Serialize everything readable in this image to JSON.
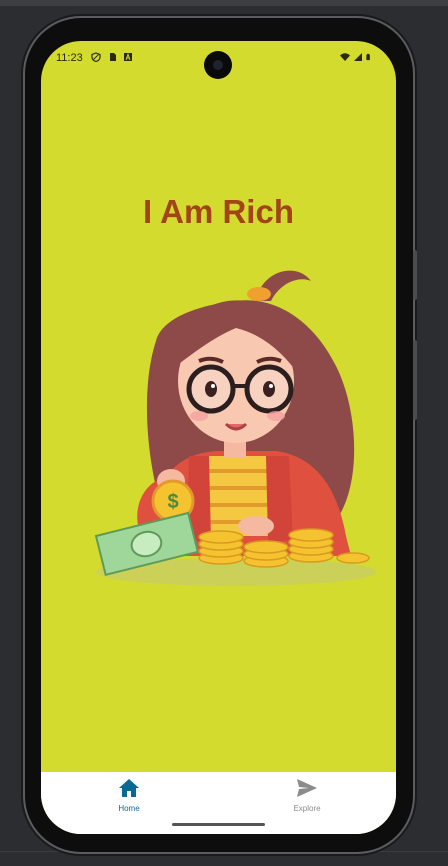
{
  "status_bar": {
    "time": "11:23",
    "left_icons": [
      "shield-icon",
      "sim-icon",
      "font-a-icon"
    ],
    "right_icons": [
      "wifi-icon",
      "signal-icon",
      "battery-icon"
    ]
  },
  "app": {
    "title": "I Am Rich",
    "background_color": "#d4db2f",
    "title_color": "#a34418",
    "illustration": "girl-with-coins-and-money"
  },
  "bottom_nav": {
    "items": [
      {
        "label": "Home",
        "icon": "home-icon",
        "selected": true
      },
      {
        "label": "Explore",
        "icon": "send-icon",
        "selected": false
      }
    ],
    "active_color": "#0b6a94",
    "inactive_color": "#8b8b8b"
  }
}
